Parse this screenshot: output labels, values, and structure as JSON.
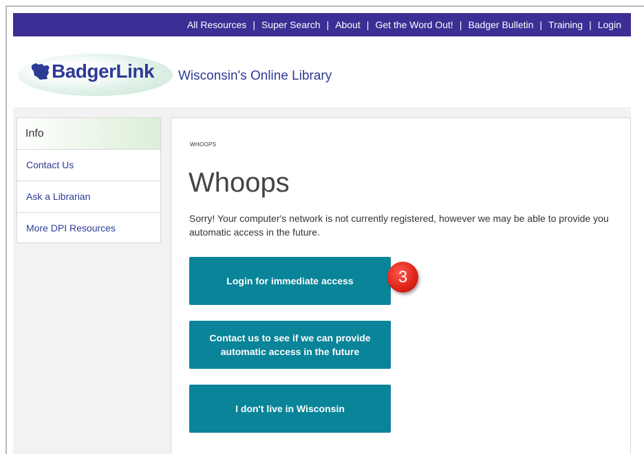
{
  "topnav": {
    "links": [
      "All Resources",
      "Super Search",
      "About",
      "Get the Word Out!",
      "Badger Bulletin",
      "Training",
      "Login"
    ],
    "separator": "|",
    "bg_color": "#3b2e94"
  },
  "header": {
    "logo_text": "BadgerLink",
    "logo_icon": "wisconsin-state-icon",
    "tagline": "Wisconsin's Online Library"
  },
  "sidebar": {
    "heading": "Info",
    "items": [
      "Contact Us",
      "Ask a Librarian",
      "More DPI Resources"
    ]
  },
  "main": {
    "breadcrumb": "WHOOPS",
    "title": "Whoops",
    "message": "Sorry!  Your computer's network is not currently registered, however we may be able to provide you automatic access in the future.",
    "buttons": [
      "Login for immediate access",
      "Contact us to see if we can provide automatic access in the future",
      "I don't live in Wisconsin"
    ],
    "button_color": "#098499"
  },
  "annotation": {
    "step_number": "3",
    "color": "#e0251b"
  }
}
